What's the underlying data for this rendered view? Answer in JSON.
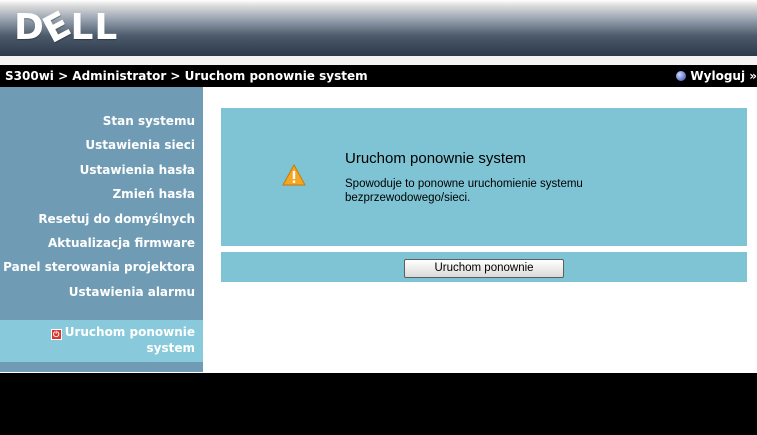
{
  "header": {
    "logo_text": "DELL",
    "logo_parts": [
      "D",
      "E",
      "LL"
    ]
  },
  "breadcrumb": "S300wi > Administrator > Uruchom ponownie system",
  "logout_label": "Wyloguj »",
  "sidebar": {
    "items": [
      {
        "label": "Stan systemu"
      },
      {
        "label": "Ustawienia sieci"
      },
      {
        "label": "Ustawienia hasła"
      },
      {
        "label": "Zmień hasła"
      },
      {
        "label": "Resetuj do domyślnych"
      },
      {
        "label": "Aktualizacja firmware"
      },
      {
        "label": "Panel sterowania projektora"
      },
      {
        "label": "Ustawienia alarmu"
      }
    ],
    "active": {
      "label_line1": "Uruchom ponownie",
      "label_line2": "system",
      "icon": "power-icon"
    }
  },
  "panel": {
    "title": "Uruchom ponownie system",
    "description": "Spowoduje to ponowne uruchomienie systemu bezprzewodowego/sieci.",
    "icon": "warning-icon"
  },
  "restart_button_label": "Uruchom ponownie",
  "colors": {
    "sidebar": "#6f9cb4",
    "sidebar_active": "#88cadb",
    "panel": "#7ec4d4",
    "bar": "#000000",
    "warning": "#f5a623"
  }
}
